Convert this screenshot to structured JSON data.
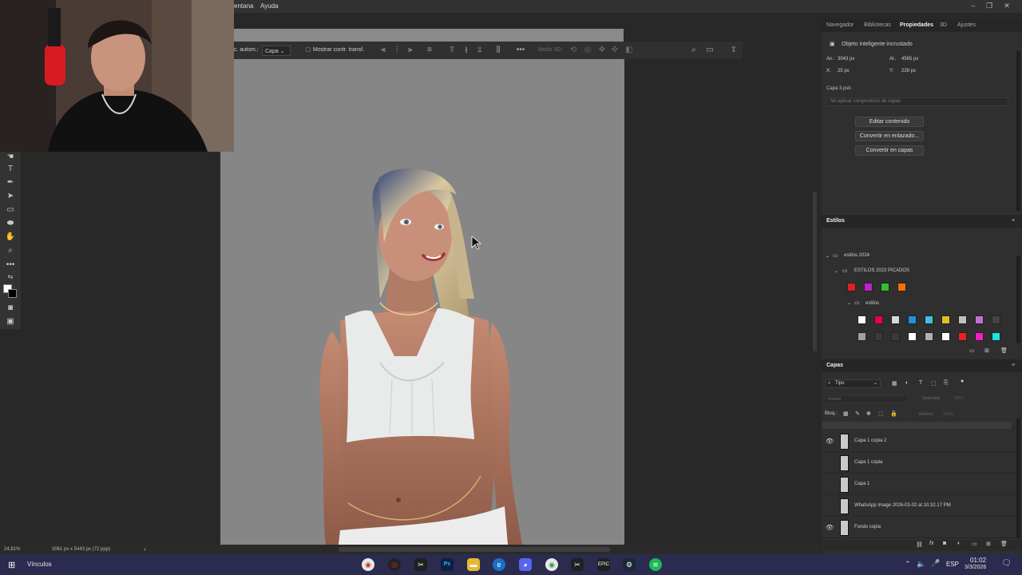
{
  "menu": {
    "items": [
      "entana",
      "Ayuda"
    ]
  },
  "options_bar": {
    "auto_select_label": "c. autom.:",
    "layer_select": "Capa",
    "show_transform_label": "Mostrar contr. transf.",
    "mode_3d_label": "Modo 3D:"
  },
  "properties_panel": {
    "tabs": [
      "Navegador",
      "Bibliotecas",
      "Propiedades",
      "3D",
      "Ajustes"
    ],
    "active_tab": "Propiedades",
    "object_type": "Objeto inteligente incrustado",
    "width_label": "An.:",
    "width_value": "3043 px",
    "height_label": "Al.:",
    "height_value": "4565 px",
    "x_label": "X:",
    "x_value": "25 px",
    "y_label": "Y:",
    "y_value": "228 px",
    "file_name": "Capa 3.psb",
    "comp_placeholder": "No aplicar composición de capas",
    "buttons": [
      "Editar contenido",
      "Convertir en enlazado...",
      "Convertir en capas"
    ]
  },
  "styles_panel": {
    "title": "Estilos",
    "group_root": "estilos 2024",
    "group_sub": "ESTILOS 2023 PICADOS",
    "group_sub2": "estilos",
    "row1_colors": [
      "#e02020",
      "#c020d0",
      "#30c030",
      "#f07010"
    ],
    "row2_colors": [
      "#ffffff",
      "#e8004a",
      "#d8d8d8",
      "#2090e0",
      "#40c0e0",
      "#e0c020",
      "#c0c0c0",
      "#c070d0",
      "#444444"
    ],
    "row3_colors": [
      "#a0a0a0",
      "#3a3a3a",
      "#3a3a3a",
      "#ffffff",
      "#b0b0b0",
      "#ffffff",
      "#f02020",
      "#f020c0",
      "#20e0e0"
    ]
  },
  "layers_panel": {
    "title": "Capas",
    "filter_label": "Tipo",
    "blend_mode": "Normal",
    "opacity_label": "Opacidad:",
    "opacity_value": "100%",
    "lock_label": "Bloq.:",
    "fill_label": "Relleno:",
    "fill_value": "100%",
    "layers": [
      {
        "name": "Capa 1 copia 2",
        "visible": true
      },
      {
        "name": "Capa 1 copia",
        "visible": false
      },
      {
        "name": "Capa 1",
        "visible": false
      },
      {
        "name": "WhatsApp Image 2026-03-02 at 10.32.17 PM",
        "visible": false
      },
      {
        "name": "Fondo copia",
        "visible": true
      }
    ]
  },
  "status_bar": {
    "zoom": "24,81%",
    "doc_size": "3061 px x 5443 px (72 ppp)"
  },
  "taskbar": {
    "widget_label": "Vínculos",
    "language": "ESP",
    "time": "01:02",
    "date": "3/3/2026"
  },
  "colors": {
    "accent": "#2b2b4f",
    "panel_bg": "#2f2f2f",
    "canvas_bg": "#868686"
  }
}
